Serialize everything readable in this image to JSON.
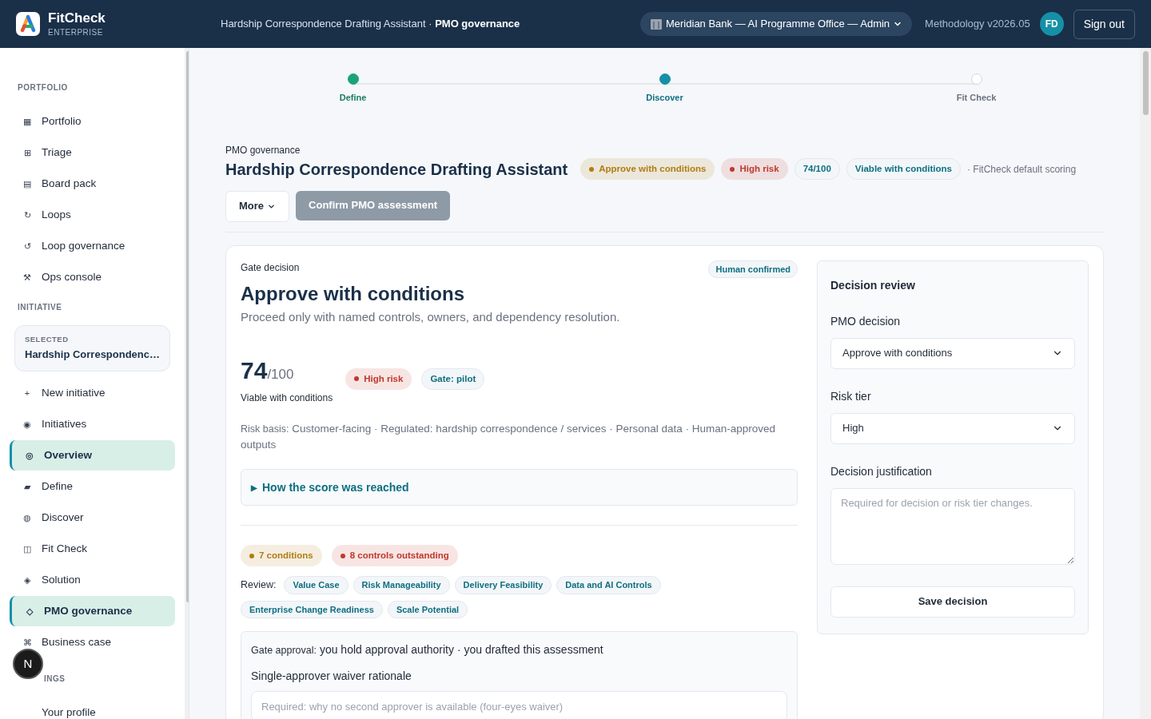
{
  "header": {
    "brand": "FitCheck",
    "edition": "ENTERPRISE",
    "context_title": "Hardship Correspondence Drafting Assistant",
    "context_section": "PMO governance",
    "separator": "·",
    "org_switcher": "Meridian Bank — AI Programme Office — Admin",
    "methodology": "Methodology v2026.05",
    "avatar": "FD",
    "sign_out": "Sign out"
  },
  "sidebar": {
    "sections": [
      {
        "heading": "PORTFOLIO",
        "items": [
          {
            "icon": "▦",
            "label": "Portfolio",
            "selected": false
          },
          {
            "icon": "⊞",
            "label": "Triage",
            "selected": false
          },
          {
            "icon": "▤",
            "label": "Board pack",
            "selected": false
          },
          {
            "icon": "↻",
            "label": "Loops",
            "selected": false
          },
          {
            "icon": "↺",
            "label": "Loop governance",
            "selected": false
          },
          {
            "icon": "⚒",
            "label": "Ops console",
            "selected": false
          }
        ]
      },
      {
        "heading": "INITIATIVE",
        "selected_card": {
          "caption": "SELECTED",
          "title": "Hardship Correspondenc…"
        },
        "items": [
          {
            "icon": "+",
            "label": "New initiative",
            "selected": false
          },
          {
            "icon": "◉",
            "label": "Initiatives",
            "selected": false
          },
          {
            "icon": "◎",
            "label": "Overview",
            "selected": true
          },
          {
            "icon": "▰",
            "label": "Define",
            "selected": false
          },
          {
            "icon": "◍",
            "label": "Discover",
            "selected": false
          },
          {
            "icon": "◫",
            "label": "Fit Check",
            "selected": false
          },
          {
            "icon": "◈",
            "label": "Solution",
            "selected": false
          },
          {
            "icon": "◇",
            "label": "PMO governance",
            "selected": true
          },
          {
            "icon": "⌘",
            "label": "Business case",
            "selected": false
          }
        ]
      },
      {
        "heading": "INGS",
        "items": [
          {
            "label": "Your profile",
            "selected": false
          }
        ]
      }
    ],
    "floating_badge": "N"
  },
  "stepper": [
    {
      "label": "Define",
      "done": true,
      "selected": false
    },
    {
      "label": "Discover",
      "done": false,
      "selected": true
    },
    {
      "label": "Fit Check",
      "done": false,
      "selected": false
    }
  ],
  "page": {
    "eyebrow": "PMO governance",
    "title": "Hardship Correspondence Drafting Assistant",
    "badges": [
      {
        "text": "Approve with conditions",
        "kind": "dot",
        "color": "#b07d12"
      },
      {
        "text": "High risk",
        "kind": "dot",
        "color": "#c0392b"
      },
      {
        "text": "74/100",
        "kind": "plain",
        "color": "#0e6f80"
      },
      {
        "text": "Viable with conditions",
        "kind": "plain",
        "color": "#0e6f80"
      }
    ],
    "scoring_note": "· FitCheck default scoring",
    "more_button": "More",
    "confirm_button": "Confirm PMO assessment"
  },
  "gate": {
    "label": "Gate decision",
    "confirmed_badge": "Human confirmed",
    "decision": "Approve with conditions",
    "description": "Proceed only with named controls, owners, and dependency resolution.",
    "score": "74",
    "score_max": "/100",
    "score_label": "Viable with conditions",
    "score_badges": [
      {
        "text": "High risk",
        "kind": "dot",
        "color": "#c0392b"
      },
      {
        "text": "Gate: pilot",
        "kind": "plain",
        "color": "#0e6f80"
      }
    ],
    "risk_basis_label": "Risk basis:",
    "risk_basis": "Customer-facing · Regulated: hardship correspondence / services · Personal data · Human-approved outputs",
    "explainer": {
      "icon": "▶",
      "label": "How the score was reached",
      "expanded": false
    },
    "status_badges": [
      {
        "text": "7 conditions",
        "color": "#b07d12"
      },
      {
        "text": "8 controls outstanding",
        "color": "#c0392b"
      }
    ],
    "review_label": "Review:",
    "review_tags": [
      "Value Case",
      "Risk Manageability",
      "Delivery Feasibility",
      "Data and AI Controls",
      "Enterprise Change Readiness",
      "Scale Potential"
    ],
    "approval": {
      "label": "Gate approval:",
      "text": "you hold approval authority · you drafted this assessment",
      "field_label": "Single-approver waiver rationale",
      "placeholder": "Required: why no second approver is available (four-eyes waiver)"
    }
  },
  "review": {
    "title": "Decision review",
    "pmo_label": "PMO decision",
    "pmo_value": "Approve with conditions",
    "risk_label": "Risk tier",
    "risk_value": "High",
    "justification_label": "Decision justification",
    "justification_placeholder": "Required for decision or risk tier changes.",
    "save_button": "Save decision"
  }
}
